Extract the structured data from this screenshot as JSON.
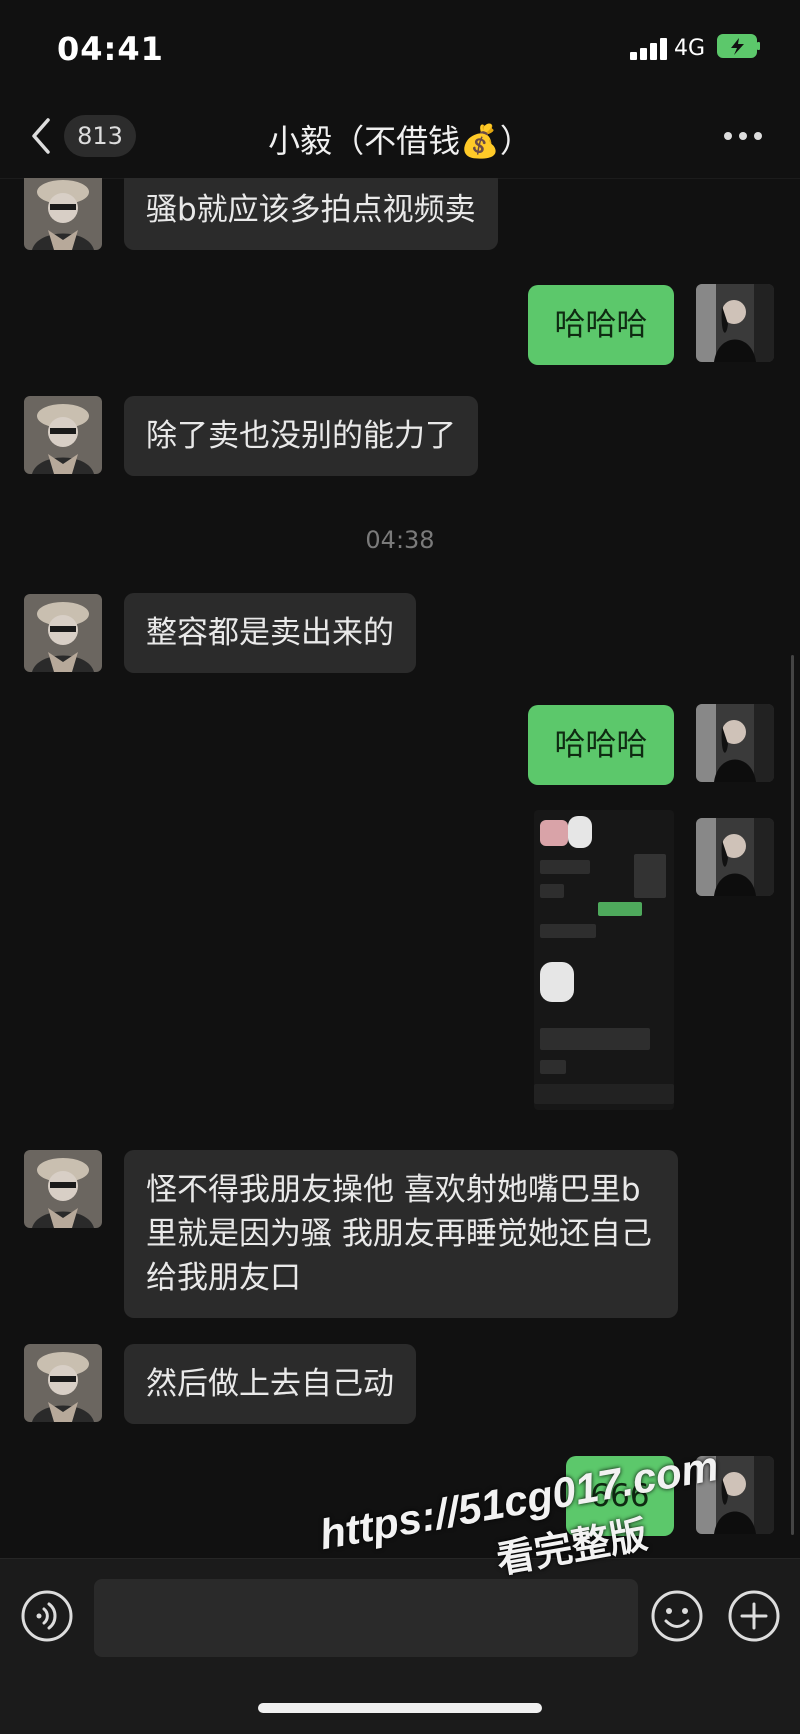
{
  "status_bar": {
    "time": "04:41",
    "network": "4G",
    "battery_color": "#5cc86b"
  },
  "header": {
    "back_count": "813",
    "title": "小毅（不借钱💰）"
  },
  "messages": [
    {
      "direction": "in",
      "text": "骚b就应该多拍点视频卖"
    },
    {
      "direction": "out",
      "text": "哈哈哈"
    },
    {
      "direction": "in",
      "text": "除了卖也没别的能力了"
    },
    {
      "type": "time",
      "text": "04:38"
    },
    {
      "direction": "in",
      "text": "整容都是卖出来的"
    },
    {
      "direction": "out",
      "text": "哈哈哈"
    },
    {
      "direction": "out",
      "type": "image",
      "text": ""
    },
    {
      "direction": "in",
      "text": "怪不得我朋友操他 喜欢射她嘴巴里b里就是因为骚 我朋友再睡觉她还自己给我朋友口"
    },
    {
      "direction": "in",
      "text": "然后做上去自己动"
    },
    {
      "direction": "out",
      "text": "666"
    }
  ],
  "watermark": {
    "line1": "https://51cg017.com",
    "line2": "看完整版"
  },
  "colors": {
    "outgoing_bubble": "#5cc86b",
    "incoming_bubble": "#2b2b2b",
    "background": "#111111"
  }
}
